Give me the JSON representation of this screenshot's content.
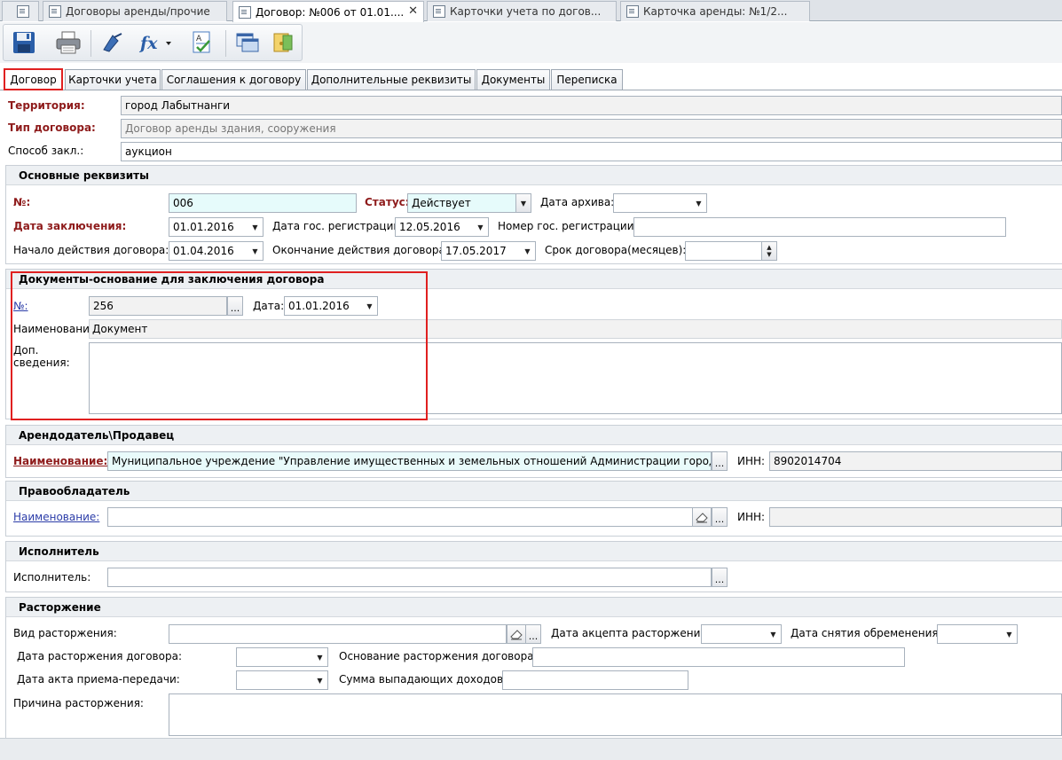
{
  "doc_tabs": [
    {
      "label": "Договоры аренды/прочие"
    },
    {
      "label": "Договор: №006 от 01.01...."
    },
    {
      "label": "Карточки учета по догов..."
    },
    {
      "label": "Карточка аренды: №1/2..."
    }
  ],
  "close_glyph": "✕",
  "form_tabs": [
    {
      "label": "Договор"
    },
    {
      "label": "Карточки учета"
    },
    {
      "label": "Соглашения к договору"
    },
    {
      "label": "Дополнительные реквизиты"
    },
    {
      "label": "Документы"
    },
    {
      "label": "Переписка"
    }
  ],
  "header": {
    "territory_label": "Территория:",
    "territory_value": "город Лабытнанги",
    "type_label": "Тип договора:",
    "type_value": "Договор аренды здания, сооружения",
    "method_label": "Способ закл.:",
    "method_value": "аукцион"
  },
  "main": {
    "title": "Основные реквизиты",
    "number_label": "№:",
    "number_value": "006",
    "status_label": "Статус:",
    "status_value": "Действует",
    "archive_label": "Дата архива:",
    "archive_value": "",
    "conclusion_label": "Дата заключения:",
    "conclusion_value": "01.01.2016",
    "reg_date_label": "Дата гос. регистрации:",
    "reg_date_value": "12.05.2016",
    "reg_num_label": "Номер гос. регистрации:",
    "reg_num_value": "",
    "start_label": "Начало действия договора:",
    "start_value": "01.04.2016",
    "end_label": "Окончание действия договора:",
    "end_value": "17.05.2017",
    "term_label": "Срок договора(месяцев):",
    "term_value": ""
  },
  "basis": {
    "title": "Документы-основание для заключения договора",
    "number_label": "№:",
    "number_value": "256",
    "date_label": "Дата:",
    "date_value": "01.01.2016",
    "name_label": "Наименование",
    "name_value": "Документ",
    "notes_label": "Доп. сведения:",
    "notes_value": ""
  },
  "landlord": {
    "title": "Арендодатель\\Продавец",
    "name_label": "Наименование:",
    "name_value": "Муниципальное учреждение \"Управление имущественных и земельных отношений Администрации города Лабытнанги\"",
    "inn_label": "ИНН:",
    "inn_value": "8902014704"
  },
  "rightholder": {
    "title": "Правообладатель",
    "name_label": "Наименование:",
    "name_value": "",
    "inn_label": "ИНН:",
    "inn_value": ""
  },
  "executor": {
    "title": "Исполнитель",
    "label": "Исполнитель:",
    "value": ""
  },
  "termination": {
    "title": "Расторжение",
    "kind_label": "Вид расторжения:",
    "kind_value": "",
    "accept_label": "Дата акцепта расторжения:",
    "accept_value": "",
    "encumbrance_label": "Дата снятия обременения:",
    "encumbrance_value": "",
    "term_date_label": "Дата расторжения договора:",
    "term_date_value": "",
    "basis_label": "Основание расторжения договора:",
    "basis_value": "",
    "act_label": "Дата акта приема-передачи:",
    "act_value": "",
    "lost_income_label": "Сумма выпадающих доходов:",
    "lost_income_value": "",
    "reason_label": "Причина расторжения:",
    "reason_value": ""
  },
  "icons": [
    "save-icon",
    "print-icon",
    "brush-icon",
    "fx-icon",
    "spellcheck-icon",
    "window-icon",
    "folder-icon"
  ],
  "colors": {
    "required_label": "#8e1b1b",
    "highlight": "#e02020",
    "link": "#2b3ca8",
    "cyan_field": "#e6fbfb"
  }
}
